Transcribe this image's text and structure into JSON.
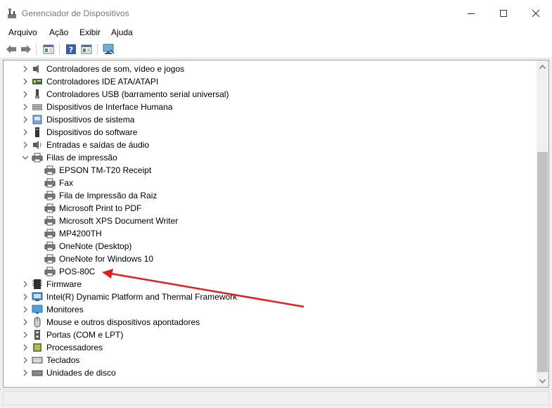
{
  "window": {
    "title": "Gerenciador de Dispositivos",
    "app_icon": "device-manager-icon",
    "controls": [
      "minimize-icon",
      "maximize-icon",
      "close-icon"
    ]
  },
  "menu": {
    "items": [
      "Arquivo",
      "Ação",
      "Exibir",
      "Ajuda"
    ]
  },
  "toolbar": {
    "buttons": [
      "back-arrow-icon",
      "forward-arrow-icon",
      "properties-icon",
      "help-icon",
      "view-icon",
      "monitor-icon"
    ]
  },
  "tree": {
    "items": [
      {
        "label": "Controladores de som, vídeo e jogos",
        "icon": "speaker-icon",
        "expanded": false
      },
      {
        "label": "Controladores IDE ATA/ATAPI",
        "icon": "ide-controller-icon",
        "expanded": false
      },
      {
        "label": "Controladores USB (barramento serial universal)",
        "icon": "usb-icon",
        "expanded": false
      },
      {
        "label": "Dispositivos de Interface Humana",
        "icon": "hid-icon",
        "expanded": false
      },
      {
        "label": "Dispositivos de sistema",
        "icon": "system-device-icon",
        "expanded": false
      },
      {
        "label": "Dispositivos do software",
        "icon": "software-device-icon",
        "expanded": false
      },
      {
        "label": "Entradas e saídas de áudio",
        "icon": "audio-io-icon",
        "expanded": false
      },
      {
        "label": "Filas de impressão",
        "icon": "printer-icon",
        "expanded": true
      },
      {
        "label": "EPSON TM-T20 Receipt",
        "icon": "printer-icon",
        "child": true
      },
      {
        "label": "Fax",
        "icon": "printer-icon",
        "child": true
      },
      {
        "label": "Fila de Impressão da Raiz",
        "icon": "printer-icon",
        "child": true
      },
      {
        "label": "Microsoft Print to PDF",
        "icon": "printer-icon",
        "child": true
      },
      {
        "label": "Microsoft XPS Document Writer",
        "icon": "printer-icon",
        "child": true
      },
      {
        "label": "MP4200TH",
        "icon": "printer-icon",
        "child": true
      },
      {
        "label": "OneNote (Desktop)",
        "icon": "printer-icon",
        "child": true
      },
      {
        "label": "OneNote for Windows 10",
        "icon": "printer-icon",
        "child": true
      },
      {
        "label": "POS-80C",
        "icon": "printer-icon",
        "child": true
      },
      {
        "label": "Firmware",
        "icon": "firmware-icon",
        "expanded": false
      },
      {
        "label": "Intel(R) Dynamic Platform and Thermal Framework",
        "icon": "intel-device-icon",
        "expanded": false
      },
      {
        "label": "Monitores",
        "icon": "monitor-icon",
        "expanded": false
      },
      {
        "label": "Mouse e outros dispositivos apontadores",
        "icon": "mouse-icon",
        "expanded": false
      },
      {
        "label": "Portas (COM e LPT)",
        "icon": "port-icon",
        "expanded": false
      },
      {
        "label": "Processadores",
        "icon": "processor-icon",
        "expanded": false
      },
      {
        "label": "Teclados",
        "icon": "keyboard-icon",
        "expanded": false
      },
      {
        "label": "Unidades de disco",
        "icon": "disk-drive-icon",
        "expanded": false
      }
    ]
  },
  "annotation": {
    "type": "arrow",
    "color": "#e02020",
    "points_to": "POS-80C"
  },
  "colors": {
    "background": "#ffffff",
    "chrome": "#f0f0f0",
    "arrow": "#e02020"
  }
}
